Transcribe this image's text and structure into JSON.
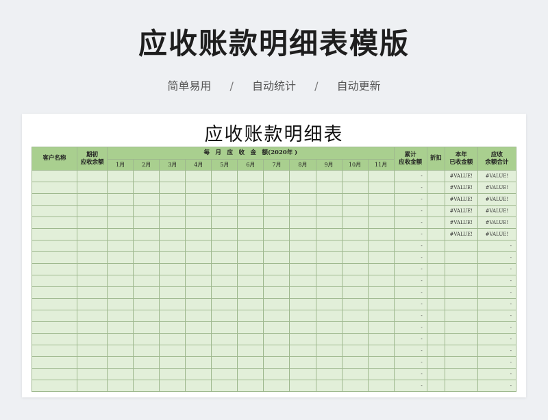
{
  "hero": {
    "title": "应收账款明细表模版"
  },
  "features": [
    "简单易用",
    "自动统计",
    "自动更新"
  ],
  "feature_separator": "/",
  "sheet": {
    "title": "应收账款明细表",
    "headers": {
      "customer": "客户名称",
      "opening_line1": "期初",
      "opening_line2": "应收余额",
      "monthly_group": "每　月　应　收　金　额(2020年 )",
      "months": [
        "1月",
        "2月",
        "3月",
        "4月",
        "5月",
        "6月",
        "7月",
        "8月",
        "9月",
        "10月",
        "11月"
      ],
      "cumulative_line1": "累计",
      "cumulative_line2": "应收金额",
      "discount": "折扣",
      "year_received_line1": "本年",
      "year_received_line2": "已收金额",
      "balance_total_line1": "应收",
      "balance_total_line2": "余额合计"
    },
    "rows": [
      {
        "cumulative": "-",
        "year_received": "#VALUE!",
        "balance_total": "#VALUE!"
      },
      {
        "cumulative": "-",
        "year_received": "#VALUE!",
        "balance_total": "#VALUE!"
      },
      {
        "cumulative": "-",
        "year_received": "#VALUE!",
        "balance_total": "#VALUE!"
      },
      {
        "cumulative": "-",
        "year_received": "#VALUE!",
        "balance_total": "#VALUE!"
      },
      {
        "cumulative": "-",
        "year_received": "#VALUE!",
        "balance_total": "#VALUE!"
      },
      {
        "cumulative": "-",
        "year_received": "#VALUE!",
        "balance_total": "#VALUE!"
      },
      {
        "cumulative": "-",
        "year_received": "",
        "balance_total": "-"
      },
      {
        "cumulative": "-",
        "year_received": "",
        "balance_total": "-"
      },
      {
        "cumulative": "-",
        "year_received": "",
        "balance_total": "-"
      },
      {
        "cumulative": "-",
        "year_received": "",
        "balance_total": "-"
      },
      {
        "cumulative": "-",
        "year_received": "",
        "balance_total": "-"
      },
      {
        "cumulative": "-",
        "year_received": "",
        "balance_total": "-"
      },
      {
        "cumulative": "-",
        "year_received": "",
        "balance_total": "-"
      },
      {
        "cumulative": "-",
        "year_received": "",
        "balance_total": "-"
      },
      {
        "cumulative": "-",
        "year_received": "",
        "balance_total": "-"
      },
      {
        "cumulative": "-",
        "year_received": "",
        "balance_total": "-"
      },
      {
        "cumulative": "-",
        "year_received": "",
        "balance_total": "-"
      },
      {
        "cumulative": "-",
        "year_received": "",
        "balance_total": "-"
      },
      {
        "cumulative": "-",
        "year_received": "",
        "balance_total": "-"
      }
    ]
  },
  "colors": {
    "header_fill": "#a9cf8f",
    "body_fill": "#e2efd9",
    "grid_line": "#9eb88e"
  }
}
